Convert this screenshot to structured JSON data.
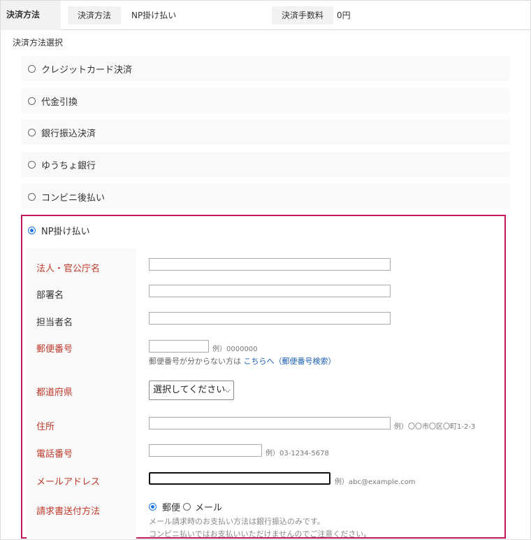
{
  "header": {
    "label": "決済方法",
    "method_pill": "決済方法",
    "method_value": "NP掛け払い",
    "fee_pill": "決済手数料",
    "fee_value": "0円"
  },
  "section_title": "決済方法選択",
  "options": [
    {
      "label": "クレジットカード決済",
      "selected": false
    },
    {
      "label": "代金引換",
      "selected": false
    },
    {
      "label": "銀行振込決済",
      "selected": false
    },
    {
      "label": "ゆうちょ銀行",
      "selected": false
    },
    {
      "label": "コンビニ後払い",
      "selected": false
    },
    {
      "label": "NP掛け払い",
      "selected": true
    }
  ],
  "form": {
    "company": {
      "label": "法人・官公庁名",
      "value": ""
    },
    "department": {
      "label": "部署名",
      "value": ""
    },
    "contact": {
      "label": "担当者名",
      "value": ""
    },
    "postal": {
      "label": "郵便番号",
      "value": "",
      "example": "例）0000000",
      "help_prefix": "郵便番号が分からない方は ",
      "help_link": "こちらへ（郵便番号検索）"
    },
    "prefecture": {
      "label": "都道府県",
      "selected": "選択してください"
    },
    "address": {
      "label": "住所",
      "value": "",
      "example": "例）〇〇市〇区〇町1-2-3"
    },
    "phone": {
      "label": "電話番号",
      "value": "",
      "example": "例）03-1234-5678"
    },
    "email": {
      "label": "メールアドレス",
      "value": "",
      "example": "例）abc@example.com"
    },
    "invoice": {
      "label": "請求書送付方法",
      "option_post": "郵便",
      "option_mail": "メール",
      "selected": "郵便",
      "note1": "メール請求時のお支払い方法は銀行振込のみです。",
      "note2": "コンビニ払いではお支払いいただけませんのでご注意ください。"
    }
  },
  "colors": {
    "required_label": "#c0392b",
    "highlight_border": "#c2185b",
    "link": "#1a5fb4",
    "radio": "#1a73e8"
  }
}
